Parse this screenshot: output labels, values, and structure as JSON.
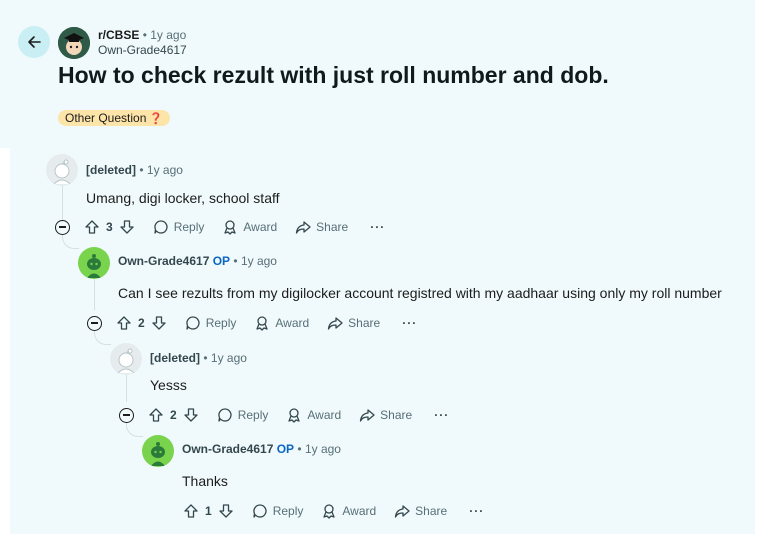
{
  "post": {
    "subreddit": "r/CBSE",
    "separator": "•",
    "age": "1y ago",
    "author": "Own-Grade4617",
    "title": "How to check rezult with just roll number and dob.",
    "flair": "Other Question",
    "flair_emoji": "❓"
  },
  "labels": {
    "reply": "Reply",
    "award": "Award",
    "share": "Share",
    "more": "···",
    "op": "OP",
    "sep": "•"
  },
  "comments": [
    {
      "author": "[deleted]",
      "age": "1y ago",
      "text": "Umang, digi locker, school staff",
      "score": "3",
      "is_op": false
    },
    {
      "author": "Own-Grade4617",
      "age": "1y ago",
      "text": "Can I see rezults from my digilocker account registred with my aadhaar using only my roll number",
      "score": "2",
      "is_op": true
    },
    {
      "author": "[deleted]",
      "age": "1y ago",
      "text": "Yesss",
      "score": "2",
      "is_op": false
    },
    {
      "author": "Own-Grade4617",
      "age": "1y ago",
      "text": "Thanks",
      "score": "1",
      "is_op": true
    }
  ]
}
